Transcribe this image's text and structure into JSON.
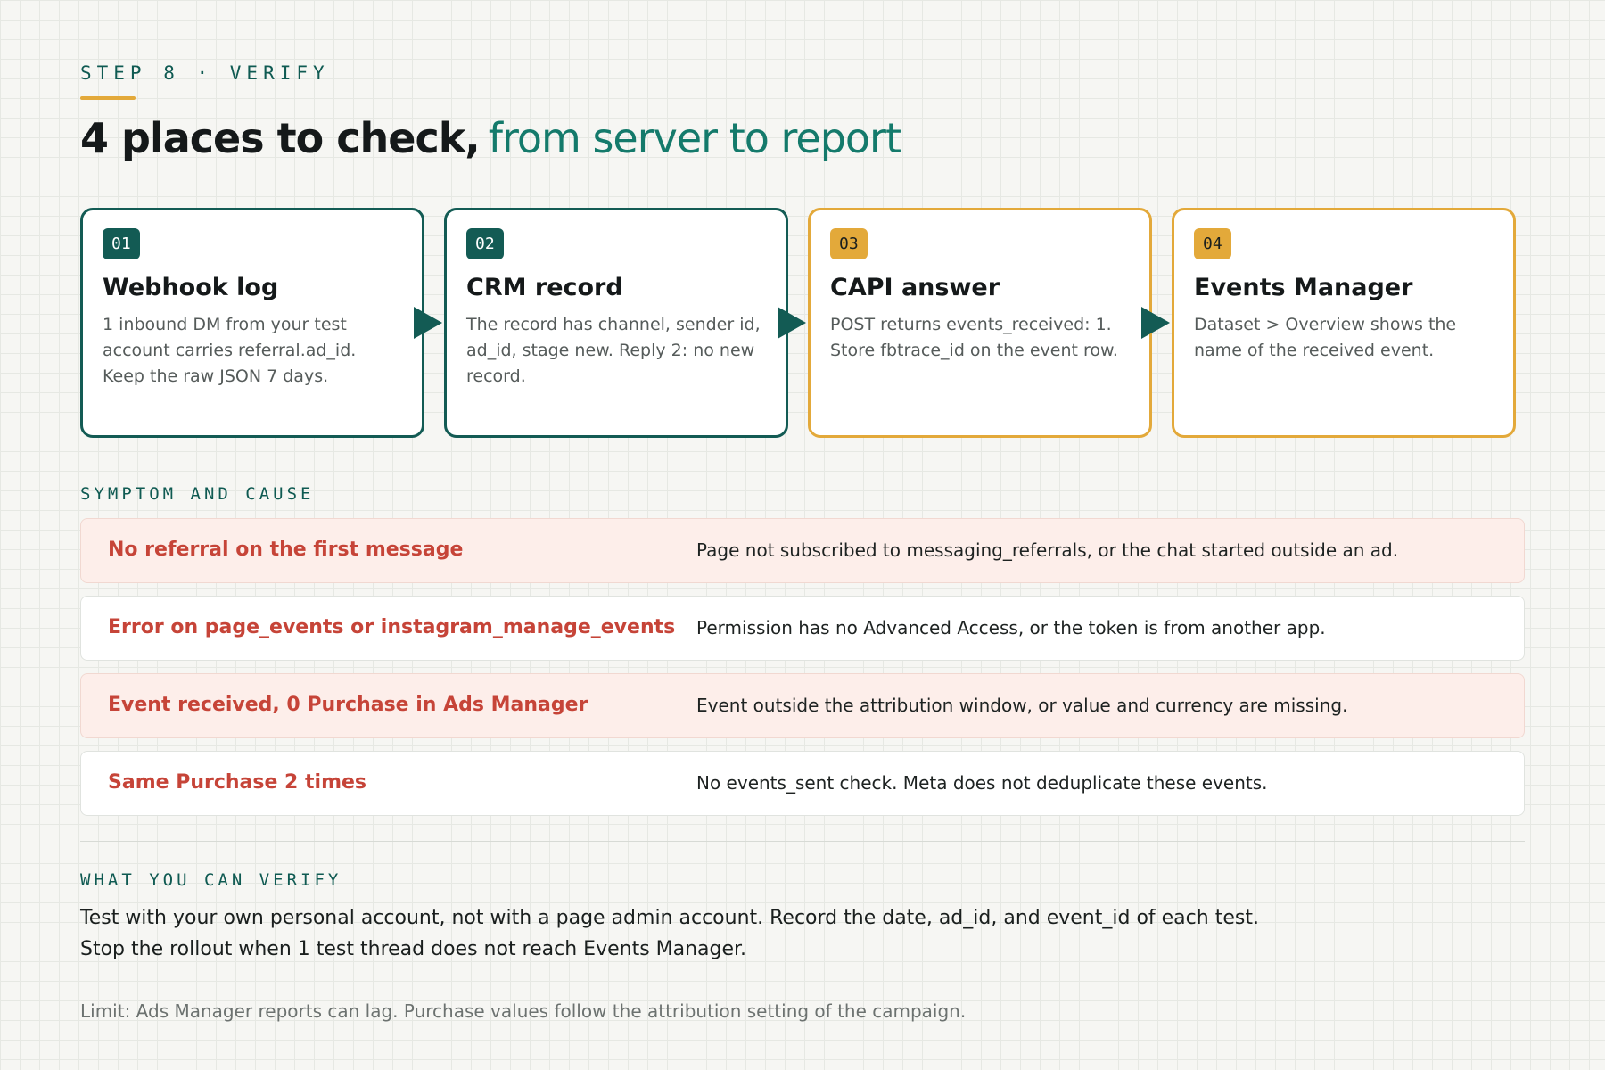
{
  "header": {
    "eyebrow": "STEP 8 · VERIFY",
    "title_main": "4 places to check,",
    "title_accent": "from server to report"
  },
  "steps": [
    {
      "badge": "01",
      "title": "Webhook log",
      "description": "1 inbound DM from your test account carries referral.ad_id. Keep the raw JSON 7 days.",
      "border_color": "#135b54"
    },
    {
      "badge": "02",
      "title": "CRM record",
      "description": "The record has channel, sender id, ad_id, stage new. Reply 2: no new record.",
      "border_color": "#135b54"
    },
    {
      "badge": "03",
      "title": "CAPI answer",
      "description": "POST returns events_received: 1. Store fbtrace_id on the event row.",
      "border_color": "#e3a93a"
    },
    {
      "badge": "04",
      "title": "Events Manager",
      "description": "Dataset > Overview shows the name of the received event.",
      "border_color": "#e3a93a"
    }
  ],
  "symptoms": {
    "label": "SYMPTOM AND CAUSE",
    "rows": [
      {
        "symptom": "No referral on the first message",
        "cause": "Page not subscribed to messaging_referrals, or the chat started outside an ad."
      },
      {
        "symptom": "Error on page_events or instagram_manage_events",
        "cause": "Permission has no Advanced Access, or the token is from another app."
      },
      {
        "symptom": "Event received, 0 Purchase in Ads Manager",
        "cause": "Event outside the attribution window, or value and currency are missing."
      },
      {
        "symptom": "Same Purchase 2 times",
        "cause": "No events_sent check. Meta does not deduplicate these events."
      }
    ]
  },
  "verify": {
    "label": "WHAT YOU CAN VERIFY",
    "line1": "Test with your own personal account, not with a page admin account. Record the date, ad_id, and event_id of each test.",
    "line2": "Stop the rollout when 1 test thread does not reach Events Manager."
  },
  "limit": "Limit: Ads Manager reports can lag. Purchase values follow the attribution setting of the campaign.",
  "colors": {
    "teal": "#135b54",
    "amber": "#e3a93a",
    "symptom_red": "#c64438",
    "row_tint": "#fdeeea"
  }
}
